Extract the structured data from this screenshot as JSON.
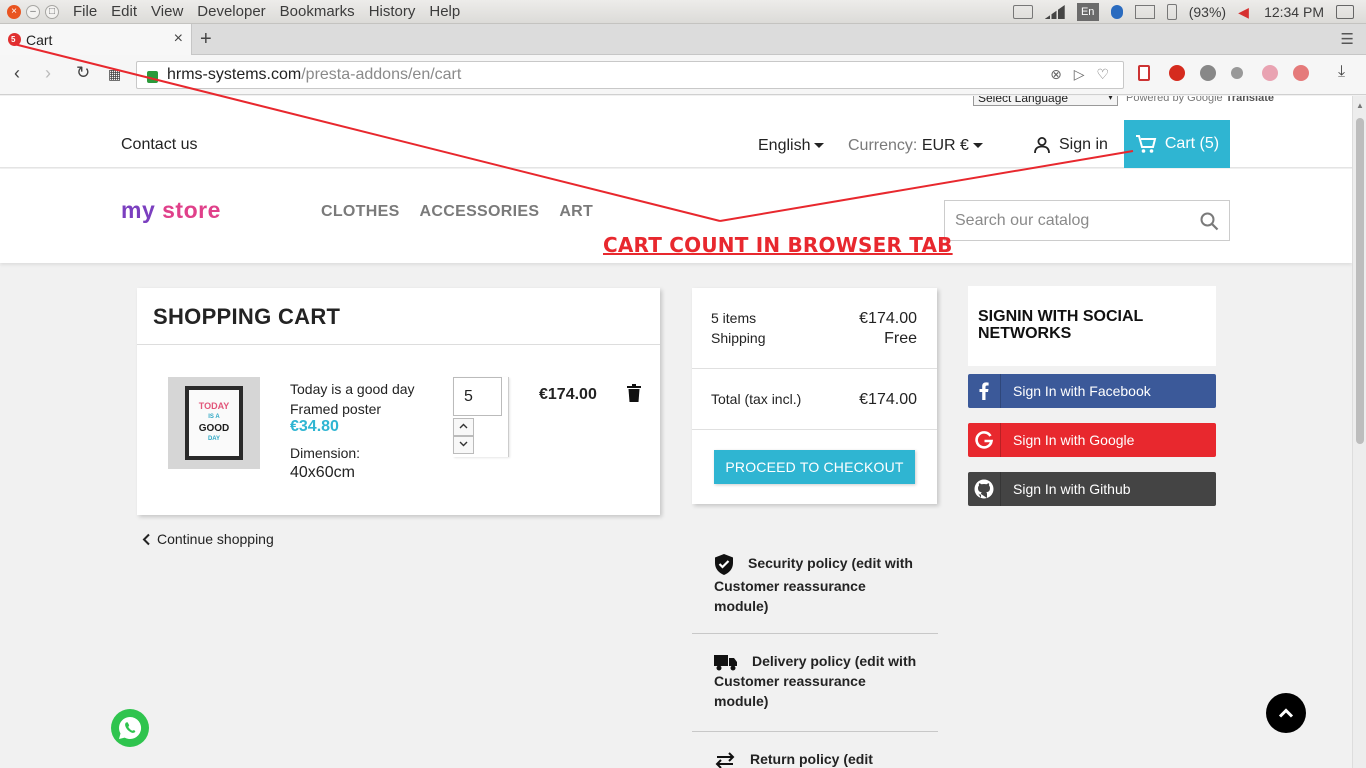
{
  "os": {
    "menu": [
      "File",
      "Edit",
      "View",
      "Developer",
      "Bookmarks",
      "History",
      "Help"
    ],
    "keyboard_layout": "En",
    "battery": "(93%)",
    "clock": "12:34 PM"
  },
  "browser": {
    "tab_title": "Cart",
    "tab_badge": "5",
    "url_host": "hrms-systems.com",
    "url_path": "/presta-addons/en/cart"
  },
  "translate": {
    "select_label": "Select Language",
    "powered_by": "Powered by",
    "google": "Google",
    "translate": "Translate"
  },
  "header": {
    "contact": "Contact us",
    "language": "English",
    "currency_label": "Currency:",
    "currency_value": "EUR €",
    "signin": "Sign in",
    "cart": "Cart (5)",
    "logo": {
      "part1": "my",
      "part2": "store"
    },
    "menu": [
      "CLOTHES",
      "ACCESSORIES",
      "ART"
    ],
    "search_placeholder": "Search our catalog"
  },
  "annotation": "CART COUNT IN BROWSER TAB",
  "cart": {
    "title": "SHOPPING CART",
    "product": {
      "name": "Today is a good day Framed poster",
      "price": "€34.80",
      "dimension_label": "Dimension:",
      "dimension_value": "40x60cm",
      "quantity": "5",
      "total": "€174.00",
      "poster_text": [
        "TODAY",
        "IS A",
        "GOOD",
        "DAY"
      ]
    },
    "continue": "Continue shopping"
  },
  "summary": {
    "items_label": "5 items",
    "items_value": "€174.00",
    "shipping_label": "Shipping",
    "shipping_value": "Free",
    "total_label": "Total (tax incl.)",
    "total_value": "€174.00",
    "checkout": "PROCEED TO CHECKOUT"
  },
  "reassurance": [
    {
      "icon": "shield-check-icon",
      "text": "Security policy (edit with Customer reassurance module)"
    },
    {
      "icon": "truck-icon",
      "text": "Delivery policy (edit with Customer reassurance module)"
    },
    {
      "icon": "swap-arrows-icon",
      "text": "Return policy (edit"
    }
  ],
  "social": {
    "title": "SIGNIN WITH SOCIAL NETWORKS",
    "facebook": "Sign In with Facebook",
    "google": "Sign In with Google",
    "github": "Sign In with Github"
  },
  "colors": {
    "accent": "#2fb5d2",
    "annotation": "#e8282e",
    "facebook": "#3b5999",
    "google": "#e8282e",
    "github": "#444444"
  }
}
